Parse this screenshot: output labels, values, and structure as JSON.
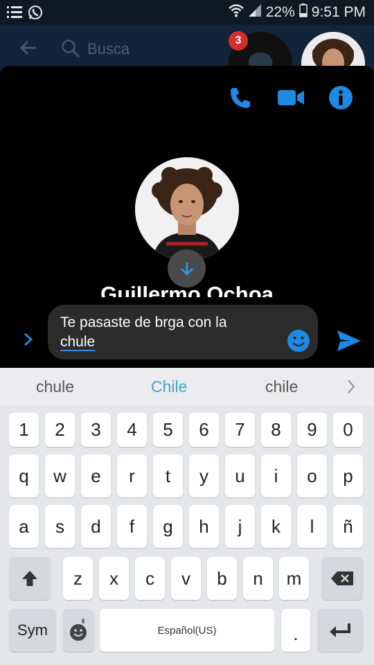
{
  "status_bar": {
    "battery": "22%",
    "time": "9:51 PM"
  },
  "background_app": {
    "search_placeholder": "Busca"
  },
  "chat_heads": {
    "unread_badge": "3"
  },
  "chat": {
    "contact_name": "Guillermo Ochoa",
    "draft_line1": "Te pasaste de brga con la",
    "draft_word": "chule"
  },
  "keyboard": {
    "suggestions": [
      "chule",
      "Chile",
      "chile"
    ],
    "number_row": [
      "1",
      "2",
      "3",
      "4",
      "5",
      "6",
      "7",
      "8",
      "9",
      "0"
    ],
    "row1": [
      "q",
      "w",
      "e",
      "r",
      "t",
      "y",
      "u",
      "i",
      "o",
      "p"
    ],
    "row2": [
      "a",
      "s",
      "d",
      "f",
      "g",
      "h",
      "j",
      "k",
      "l",
      "ñ"
    ],
    "row3": [
      "z",
      "x",
      "c",
      "v",
      "b",
      "n",
      "m"
    ],
    "sym_label": "Sym",
    "space_label": "Español(US)",
    "period_label": "."
  },
  "colors": {
    "accent": "#1e88e5",
    "suggestion_highlight": "#42a3c8",
    "badge": "#d32f2f"
  },
  "icons": [
    "menu-icon",
    "whatsapp-icon",
    "wifi-icon",
    "signal-icon",
    "battery-icon",
    "back-arrow-icon",
    "search-icon",
    "messenger-icon",
    "phone-icon",
    "video-icon",
    "info-icon",
    "arrow-down-icon",
    "chevron-right-icon",
    "emoji-icon",
    "send-icon",
    "shift-icon",
    "backspace-icon",
    "enter-icon",
    "mic-icon"
  ]
}
